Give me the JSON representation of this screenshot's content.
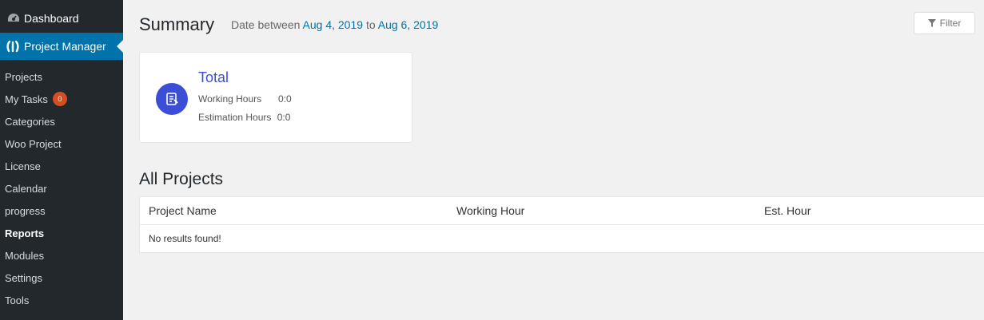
{
  "sidebar": {
    "dashboard_label": "Dashboard",
    "dashboard_icon": "gauge-icon",
    "project_manager_label": "Project Manager",
    "project_manager_icon": "project-manager-logo-icon",
    "items": [
      {
        "label": "Projects"
      },
      {
        "label": "My Tasks",
        "badge": "0"
      },
      {
        "label": "Categories"
      },
      {
        "label": "Woo Project"
      },
      {
        "label": "License"
      },
      {
        "label": "Calendar"
      },
      {
        "label": "progress"
      },
      {
        "label": "Reports",
        "current": true
      },
      {
        "label": "Modules"
      },
      {
        "label": "Settings"
      },
      {
        "label": "Tools"
      }
    ],
    "colors": {
      "bg": "#23282d",
      "active": "#0073aa",
      "badge": "#d54e21"
    }
  },
  "summary": {
    "title": "Summary",
    "date_prefix": "Date between",
    "date_from": "Aug 4, 2019",
    "date_connector": "to",
    "date_to": "Aug 6, 2019"
  },
  "filter": {
    "label": "Filter",
    "icon": "funnel-icon"
  },
  "total_card": {
    "title": "Total",
    "icon": "report-clipboard-icon",
    "working_hours_label": "Working Hours",
    "working_hours_value": "0:0",
    "estimation_hours_label": "Estimation Hours",
    "estimation_hours_value": "0:0",
    "accent": "#3b4fd6"
  },
  "projects": {
    "title": "All Projects",
    "columns": [
      "Project Name",
      "Working Hour",
      "Est. Hour"
    ],
    "empty_message": "No results found!"
  }
}
